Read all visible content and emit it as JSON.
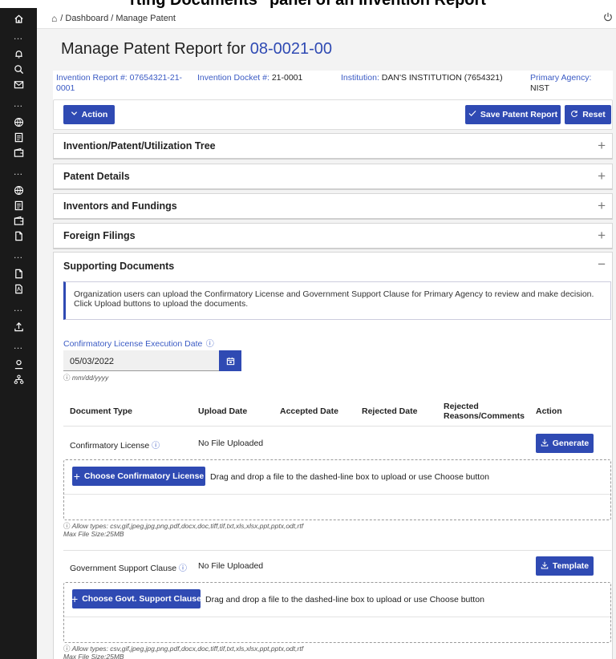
{
  "banner": {
    "title": "rting Documents\" panel of an Invention Report"
  },
  "sidebar": {
    "icons": [
      "home-icon",
      "bell-icon",
      "search-user-icon",
      "mail-icon",
      "globe-icon",
      "document-icon",
      "wallet-icon",
      "globe-icon",
      "document-icon",
      "wallet-icon",
      "file-icon",
      "file-icon",
      "pdf-icon",
      "upload-icon",
      "user-icon",
      "org-chart-icon"
    ]
  },
  "breadcrumb": {
    "items": [
      "Dashboard",
      "Manage Patent"
    ],
    "separator": " / "
  },
  "header": {
    "title_prefix": "Manage Patent Report for ",
    "title_id": "08-0021-00"
  },
  "info": {
    "invention_report_label": "Invention Report #:",
    "invention_report_value": "07654321-21-0001",
    "docket_label": "Invention Docket #:",
    "docket_value": "21-0001",
    "institution_label": "Institution:",
    "institution_value": "DAN'S INSTITUTION (7654321)",
    "agency_label": "Primary Agency:",
    "agency_value": "NIST"
  },
  "toolbar": {
    "action_label": "Action",
    "save_label": "Save Patent Report",
    "reset_label": "Reset"
  },
  "panels": [
    {
      "title": "Invention/Patent/Utilization Tree",
      "toggle": "+"
    },
    {
      "title": "Patent Details",
      "toggle": "+"
    },
    {
      "title": "Inventors and Fundings",
      "toggle": "+"
    },
    {
      "title": "Foreign Filings",
      "toggle": "+"
    }
  ],
  "docs": {
    "title": "Supporting Documents",
    "toggle": "−",
    "notice": "Organization users can upload the Confirmatory License and Government Support Clause for Primary Agency to review and make decision. Click Upload buttons to upload the documents.",
    "date_label": "Confirmatory License Execution Date",
    "date_value": "05/03/2022",
    "date_hint": "mm/dd/yyyy",
    "columns": [
      "Document Type",
      "Upload Date",
      "Accepted Date",
      "Rejected Date",
      "Rejected Reasons/Comments",
      "Action"
    ],
    "rows": [
      {
        "type": "Confirmatory License",
        "upload": "No File Uploaded",
        "action": "Generate",
        "choose": "Choose Confirmatory License"
      },
      {
        "type": "Government Support Clause",
        "upload": "No File Uploaded",
        "action": "Template",
        "choose": "Choose Govt. Support Clause"
      }
    ],
    "drop_text": "Drag and drop a file to the dashed-line box to upload or use Choose button",
    "allow_types": "Allow types: csv,gif,jpeg,jpg,png,pdf,docx,doc,tiff,tif,txt,xls,xlsx,ppt,pptx,odt,rtf",
    "max_size": "Max File Size:25MB"
  },
  "colors": {
    "accent": "#2f4ab3",
    "sidebar": "#1a1a1a",
    "background": "#f3f3f3"
  }
}
